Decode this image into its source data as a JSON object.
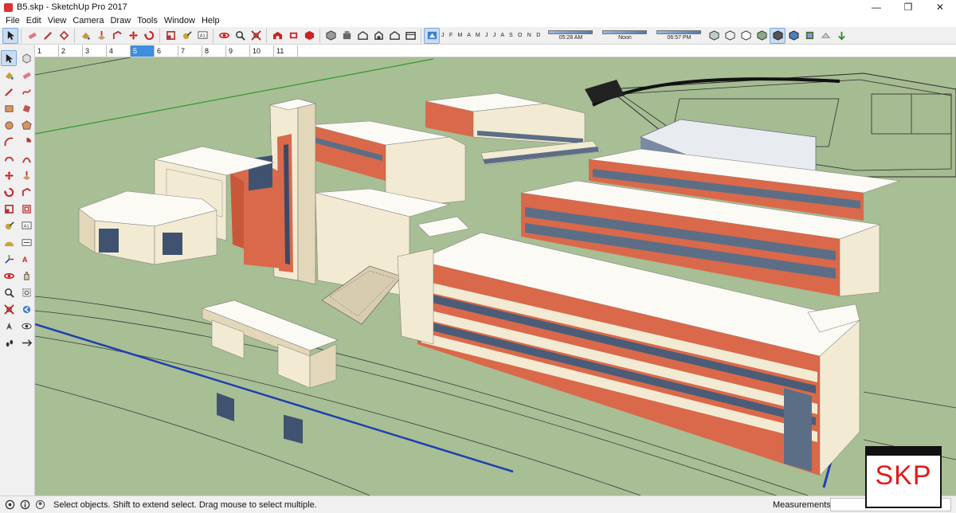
{
  "window": {
    "title": "B5.skp - SketchUp Pro 2017",
    "minimize_glyph": "—",
    "maximize_glyph": "❐",
    "close_glyph": "✕"
  },
  "menu": [
    "File",
    "Edit",
    "View",
    "Camera",
    "Draw",
    "Tools",
    "Window",
    "Help"
  ],
  "toolbar": {
    "months": "J F M A M J J A S O N D",
    "time_start": "05:28 AM",
    "time_noon": "Noon",
    "time_end": "06:57 PM"
  },
  "scene_tabs": [
    "1",
    "2",
    "3",
    "4",
    "5",
    "6",
    "7",
    "8",
    "9",
    "10",
    "11"
  ],
  "active_scene_tab": "5",
  "statusbar": {
    "hint": "Select objects. Shift to extend select. Drag mouse to select multiple.",
    "measurements_label": "Measurements",
    "measurements_value": ""
  },
  "watermark": {
    "text": "SKP"
  },
  "colors": {
    "ground": "#a8be95",
    "brick": "#d9694a",
    "cream": "#f2ead2",
    "roof": "#fbfaf5",
    "glass": "#5c6e86",
    "selection_blue": "#1f3fb0",
    "axis_green": "#2f9a2f",
    "accent_red": "#e21b1b"
  },
  "icons": {
    "toolbar": [
      "select-icon",
      "eraser-icon",
      "pencil-icon",
      "shape-icon",
      "paint-icon",
      "push-pull-icon",
      "follow-me-icon",
      "move-icon",
      "rotate-icon",
      "scale-icon",
      "tape-icon",
      "text-icon",
      "orbit-icon",
      "zoom-icon",
      "zoom-extents-icon",
      "warehouse-icon",
      "extension-icon",
      "components-icon",
      "iso-icon",
      "top-view-icon",
      "front-view-icon",
      "right-view-icon",
      "back-view-icon",
      "left-view-icon",
      "shadow-toggle-icon",
      "xray-icon",
      "wireframe-icon",
      "hidden-line-icon",
      "shaded-icon",
      "textured-icon",
      "monochrome-icon",
      "section-icon",
      "display-section-icon",
      "fog-icon"
    ],
    "left": [
      "select-icon",
      "component-icon",
      "paint-icon",
      "eraser-icon",
      "line-icon",
      "freehand-icon",
      "rectangle-icon",
      "rotated-rect-icon",
      "circle-icon",
      "polygon-icon",
      "arc-icon",
      "pie-icon",
      "two-point-arc-icon",
      "three-point-arc-icon",
      "move-icon",
      "push-pull-icon",
      "rotate-icon",
      "follow-me-icon",
      "scale-icon",
      "offset-icon",
      "tape-icon",
      "text-icon",
      "protractor-icon",
      "dimension-icon",
      "axes-icon",
      "3d-text-icon",
      "orbit-icon",
      "pan-icon",
      "zoom-icon",
      "zoom-window-icon",
      "zoom-extents-icon",
      "previous-view-icon",
      "position-camera-icon",
      "look-around-icon",
      "walk-icon",
      "section-plane-icon"
    ]
  }
}
